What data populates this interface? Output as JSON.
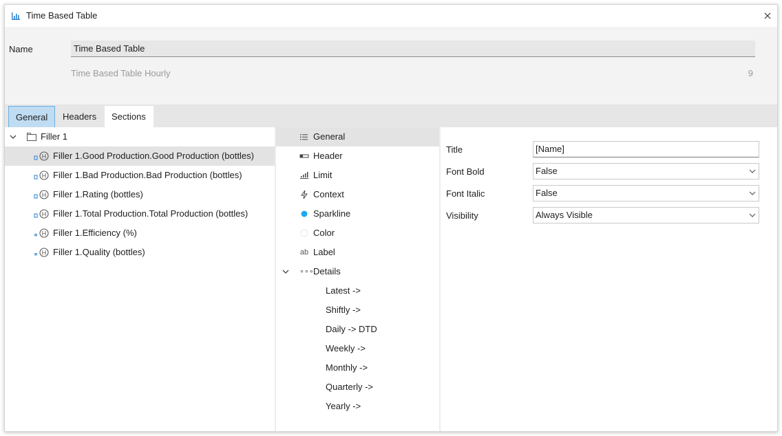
{
  "window": {
    "title": "Time Based Table"
  },
  "header": {
    "name_label": "Name",
    "name_value": "Time Based Table",
    "subtitle": "Time Based Table Hourly",
    "count": "9"
  },
  "tabs": [
    {
      "label": "General",
      "state": "selected"
    },
    {
      "label": "Headers",
      "state": "normal"
    },
    {
      "label": "Sections",
      "state": "active"
    }
  ],
  "tree": {
    "root": "Filler 1",
    "items": [
      {
        "label": "Filler 1.Good Production.Good Production (bottles)",
        "selected": true
      },
      {
        "label": "Filler 1.Bad Production.Bad Production (bottles)"
      },
      {
        "label": "Filler 1.Rating (bottles)"
      },
      {
        "label": "Filler 1.Total Production.Total Production (bottles)"
      },
      {
        "label": "Filler 1.Efficiency (%)"
      },
      {
        "label": "Filler 1.Quality (bottles)"
      }
    ]
  },
  "sections": {
    "items": [
      {
        "label": "General",
        "icon": "list-icon",
        "selected": true
      },
      {
        "label": "Header",
        "icon": "header-icon"
      },
      {
        "label": "Limit",
        "icon": "limit-icon"
      },
      {
        "label": "Context",
        "icon": "lightning-icon"
      },
      {
        "label": "Sparkline",
        "icon": "dot-icon",
        "icon_color": "#1ea7f0"
      },
      {
        "label": "Color",
        "icon": "color-circle-icon"
      },
      {
        "label": "Label",
        "icon": "ab-icon",
        "icon_text": "ab"
      },
      {
        "label": "Details",
        "icon": "dots-icon",
        "icon_text": "∘∘∘",
        "expanded": true
      }
    ],
    "details": [
      {
        "label": "Latest ->"
      },
      {
        "label": "Shiftly ->"
      },
      {
        "label": "Daily -> DTD"
      },
      {
        "label": "Weekly ->"
      },
      {
        "label": "Monthly ->"
      },
      {
        "label": "Quarterly ->"
      },
      {
        "label": "Yearly ->"
      }
    ]
  },
  "properties": [
    {
      "label": "Title",
      "value": "[Name]",
      "type": "text"
    },
    {
      "label": "Font Bold",
      "value": "False",
      "type": "dropdown"
    },
    {
      "label": "Font Italic",
      "value": "False",
      "type": "dropdown"
    },
    {
      "label": "Visibility",
      "value": "Always Visible",
      "type": "dropdown"
    }
  ],
  "colors": {
    "selection_blue": "#bfdcf3",
    "selection_border": "#6aaee0",
    "row_highlight": "#e3e3e3",
    "accent_dot": "#1ea7f0"
  }
}
